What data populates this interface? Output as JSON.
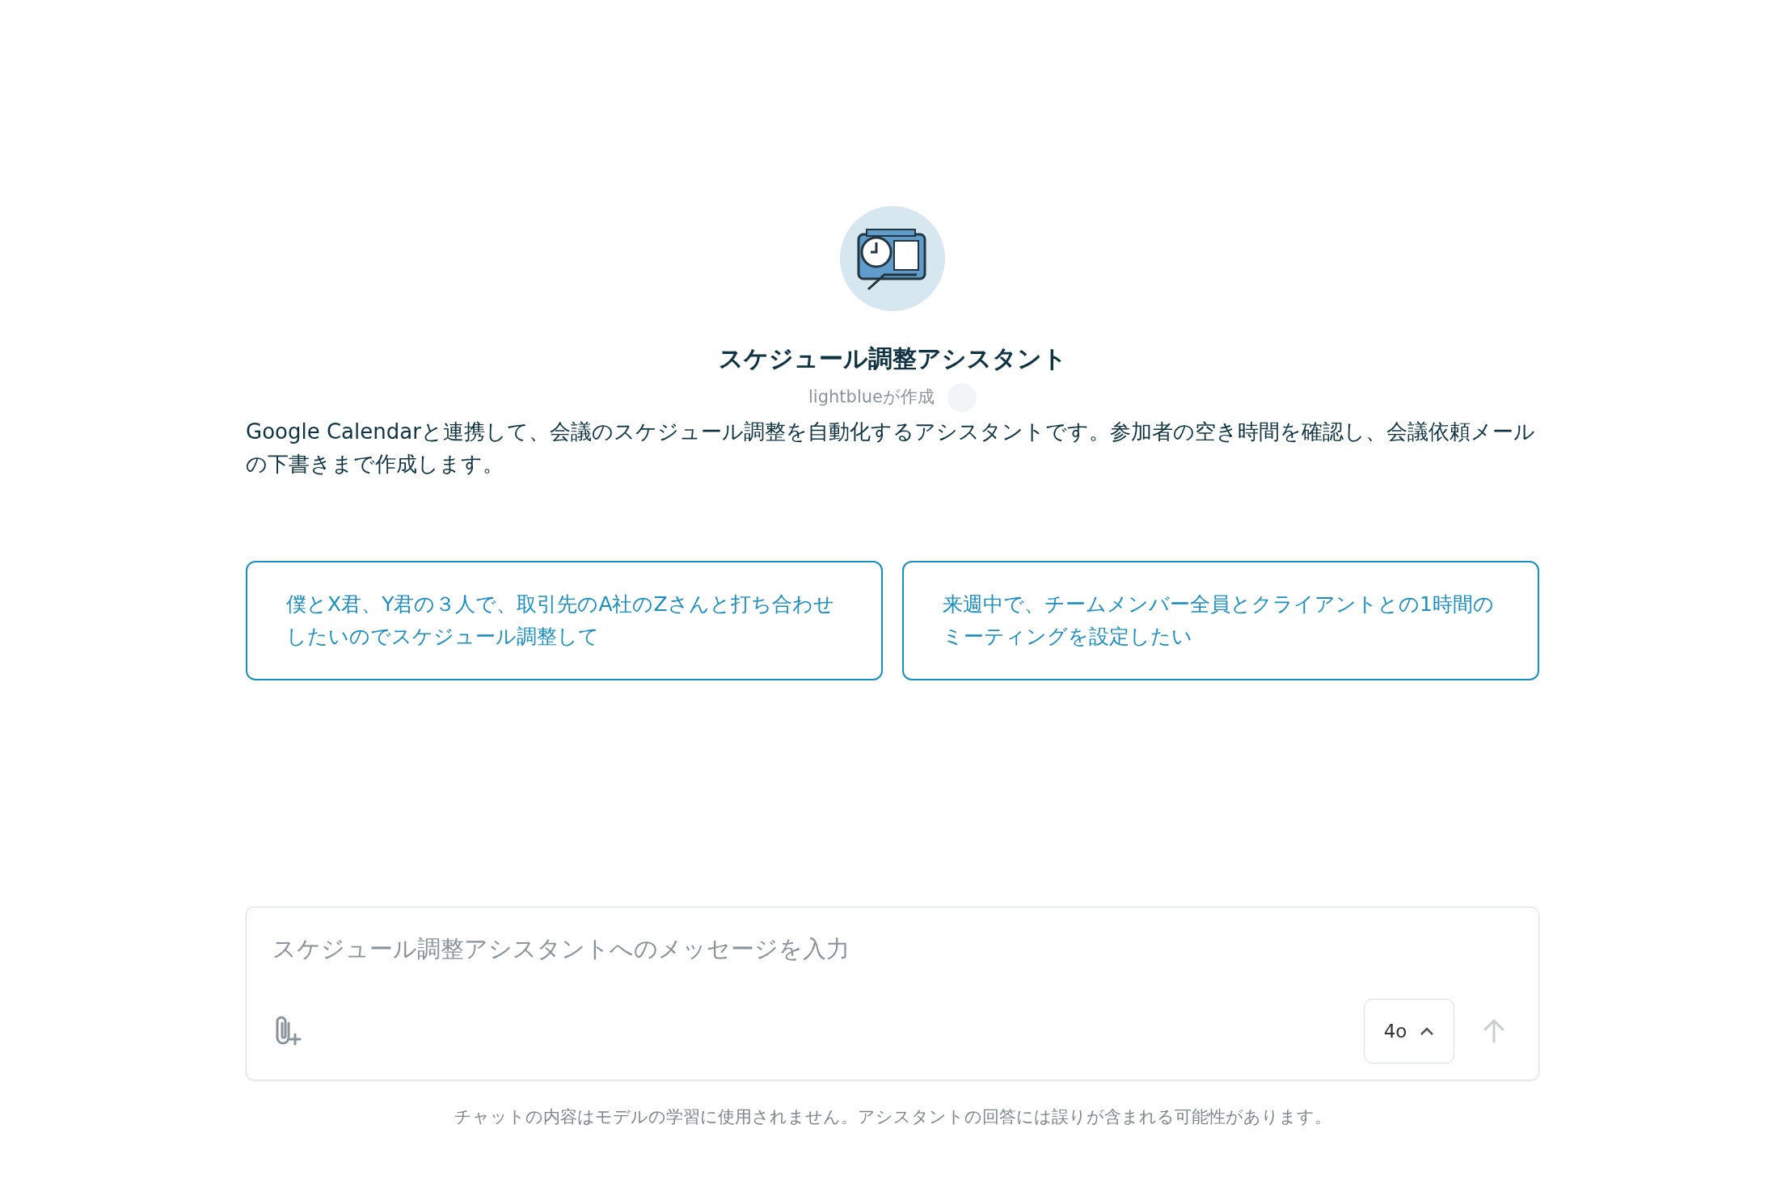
{
  "assistant": {
    "title": "スケジュール調整アシスタント",
    "byline": "lightblueが作成",
    "description": "Google Calendarと連携して、会議のスケジュール調整を自動化するアシスタントです。参加者の空き時間を確認し、会議依頼メールの下書きまで作成します。"
  },
  "suggestions": [
    {
      "text": "僕とX君、Y君の３人で、取引先のA社のZさんと打ち合わせしたいのでスケジュール調整して"
    },
    {
      "text": "来週中で、チームメンバー全員とクライアントとの1時間のミーティングを設定したい"
    }
  ],
  "composer": {
    "placeholder": "スケジュール調整アシスタントへのメッセージを入力",
    "model": "4o",
    "send_disabled": true
  },
  "footer": "チャットの内容はモデルの学習に使用されません。アシスタントの回答には誤りが含まれる可能性があります。"
}
